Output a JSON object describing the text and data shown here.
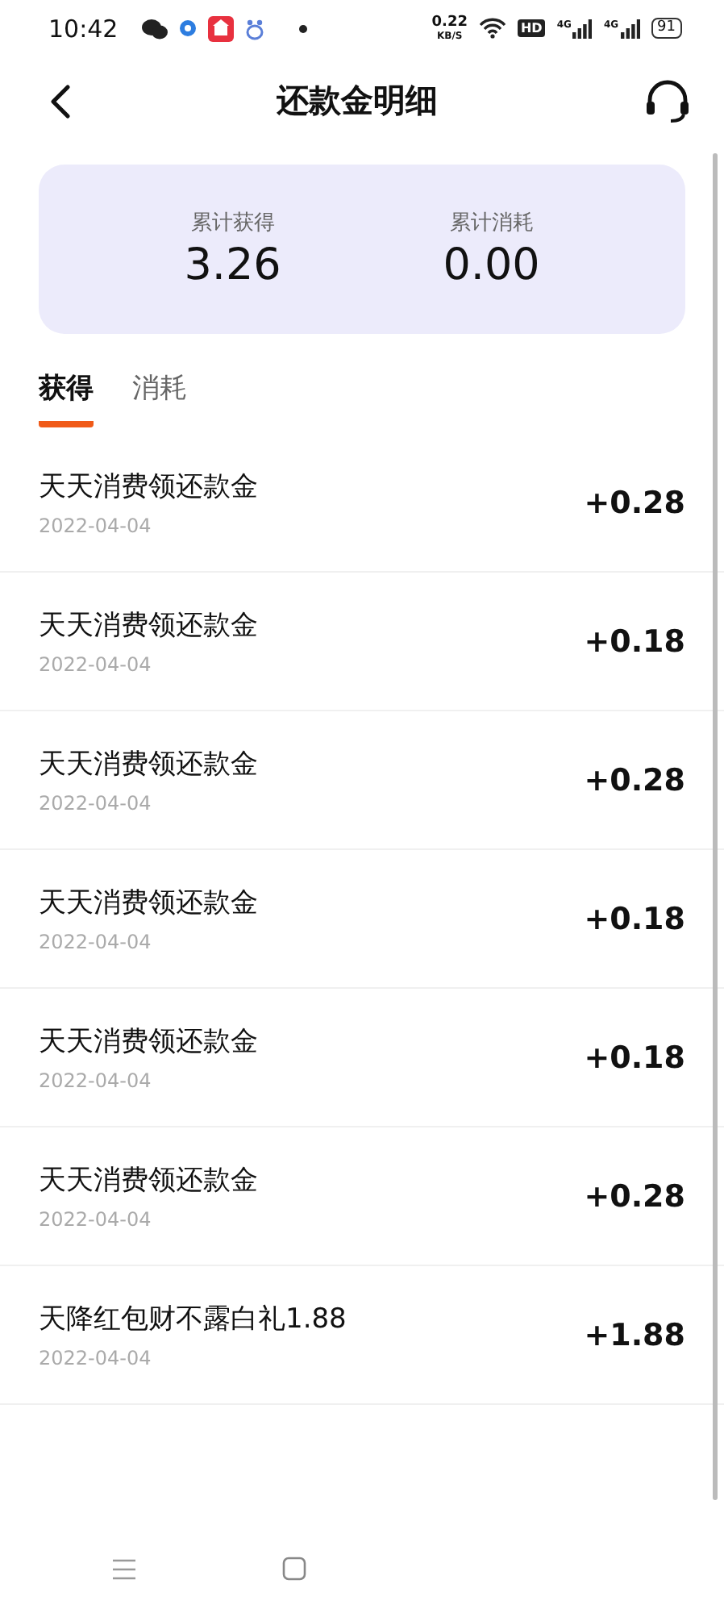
{
  "status_bar": {
    "time": "10:42",
    "net_speed": "0.22",
    "net_unit": "KB/S",
    "hd": "HD",
    "signals": [
      "4G",
      "4G"
    ],
    "battery": "91"
  },
  "header": {
    "title": "还款金明细"
  },
  "summary": [
    {
      "label": "累计获得",
      "value": "3.26"
    },
    {
      "label": "累计消耗",
      "value": "0.00"
    }
  ],
  "tabs": [
    {
      "label": "获得",
      "selected": true
    },
    {
      "label": "消耗",
      "selected": false
    }
  ],
  "records": [
    {
      "title": "天天消费领还款金",
      "date": "2022-04-04",
      "amount": "+0.28"
    },
    {
      "title": "天天消费领还款金",
      "date": "2022-04-04",
      "amount": "+0.18"
    },
    {
      "title": "天天消费领还款金",
      "date": "2022-04-04",
      "amount": "+0.28"
    },
    {
      "title": "天天消费领还款金",
      "date": "2022-04-04",
      "amount": "+0.18"
    },
    {
      "title": "天天消费领还款金",
      "date": "2022-04-04",
      "amount": "+0.18"
    },
    {
      "title": "天天消费领还款金",
      "date": "2022-04-04",
      "amount": "+0.28"
    },
    {
      "title": "天降红包财不露白礼1.88",
      "date": "2022-04-04",
      "amount": "+1.88"
    }
  ]
}
